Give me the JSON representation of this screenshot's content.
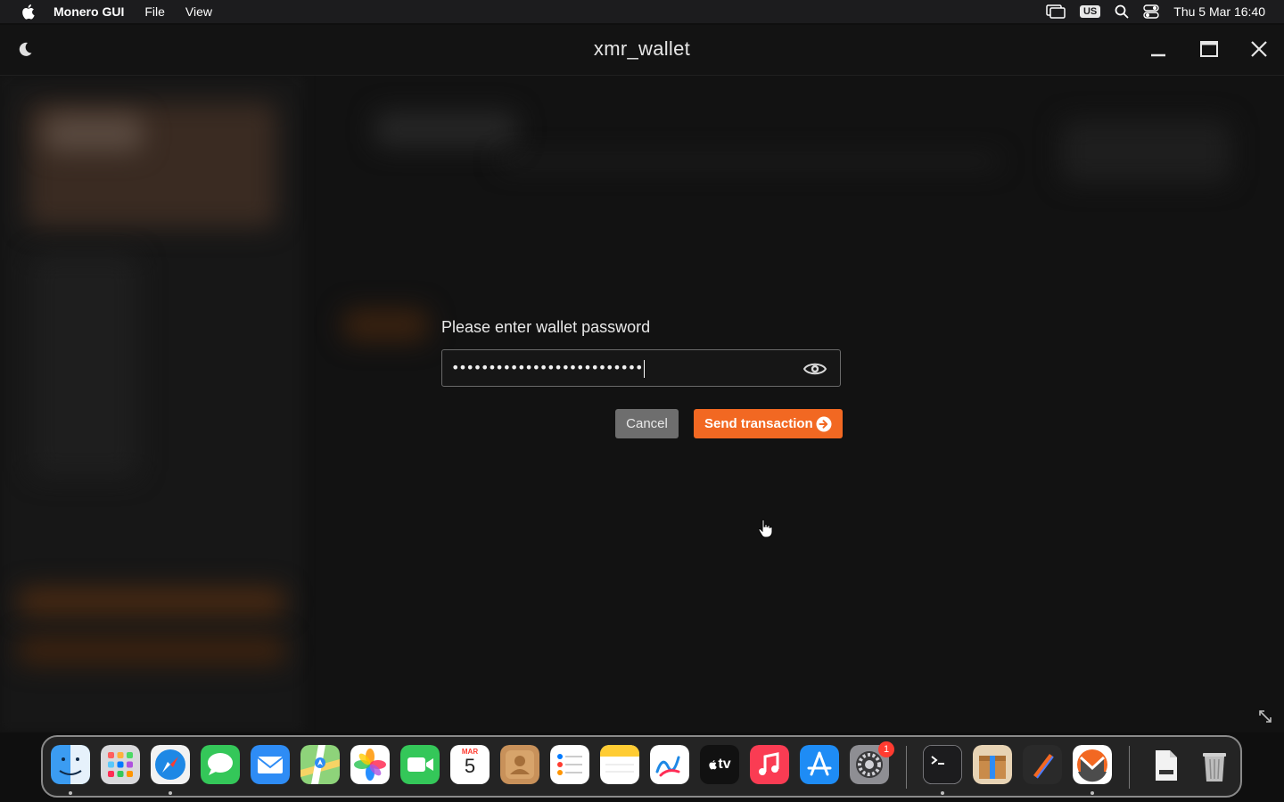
{
  "menubar": {
    "app_name": "Monero GUI",
    "menus": [
      "File",
      "View"
    ],
    "keyboard_layout": "US",
    "datetime": "Thu 5 Mar  16:40"
  },
  "window": {
    "title": "xmr_wallet",
    "controls": [
      "minimize-icon",
      "maximize-icon",
      "close-icon"
    ],
    "theme_toggle": "moon-icon"
  },
  "dialog": {
    "prompt": "Please enter wallet password",
    "password_mask": "••••••••••••••••••••••••••",
    "cancel_label": "Cancel",
    "confirm_label": "Send transaction"
  },
  "colors": {
    "accent": "#f26822",
    "cancel_bg": "#6e6e6e",
    "background": "#121212"
  },
  "dock": {
    "apps": [
      "Finder",
      "Launchpad",
      "Safari",
      "Messages",
      "Mail",
      "Maps",
      "Photos",
      "FaceTime",
      "Calendar",
      "Contacts",
      "Reminders",
      "Notes",
      "Freeform",
      "TV",
      "Music",
      "App Store",
      "System Settings",
      "Terminal",
      "Gift",
      "Pen Tool",
      "Monero",
      "Downloads",
      "Trash"
    ],
    "calendar_month": "MAR",
    "calendar_day": "5",
    "settings_badge": "1",
    "tv_label": "tv"
  }
}
